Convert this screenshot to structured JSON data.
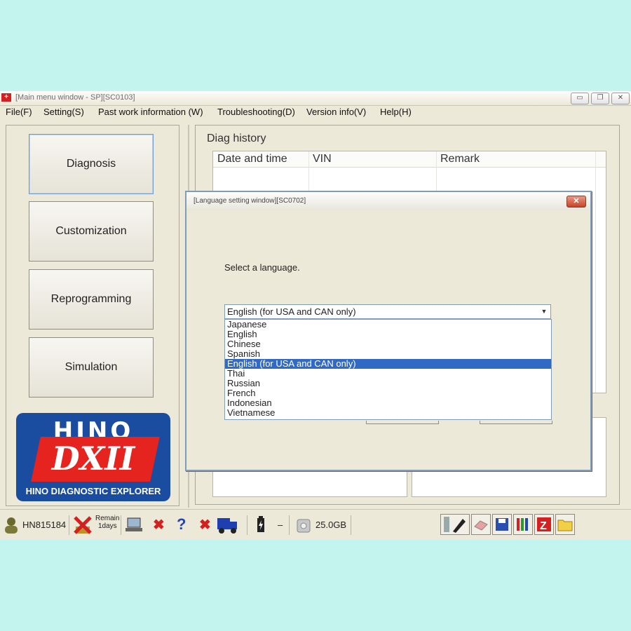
{
  "window": {
    "title": "[Main menu window - SP][SC0103]",
    "controls": {
      "minimize": "▭",
      "restore": "❐",
      "close": "✕"
    }
  },
  "menu": [
    "File(F)",
    "Setting(S)",
    "Past work information (W)",
    "Troubleshooting(D)",
    "Version info(V)",
    "Help(H)"
  ],
  "sidebar": {
    "buttons": [
      "Diagnosis",
      "Customization",
      "Reprogramming",
      "Simulation"
    ],
    "logo": {
      "brand": "HINO",
      "product": "DXII",
      "subtitle": "HINO DIAGNOSTIC EXPLORER"
    }
  },
  "history": {
    "label": "Diag history",
    "columns": [
      "Date and time",
      "VIN",
      "Remark"
    ]
  },
  "dialog": {
    "title": "[Language setting window][SC0702]",
    "prompt": "Select a language.",
    "selected": "English (for USA and CAN only)",
    "options": [
      "Japanese",
      "English",
      "Chinese",
      "Spanish",
      "English (for USA and CAN only)",
      "Thai",
      "Russian",
      "French",
      "Indonesian",
      "Vietnamese"
    ],
    "selected_index": 4
  },
  "status": {
    "user": "HN815184",
    "remain_line1": "Remain",
    "remain_line2": "1days",
    "battery": "–",
    "disk": "25.0GB"
  },
  "colors": {
    "accent": "#316ac5",
    "brand_blue": "#1a4ca0",
    "brand_red": "#e52420",
    "background": "#c4f4ee"
  }
}
